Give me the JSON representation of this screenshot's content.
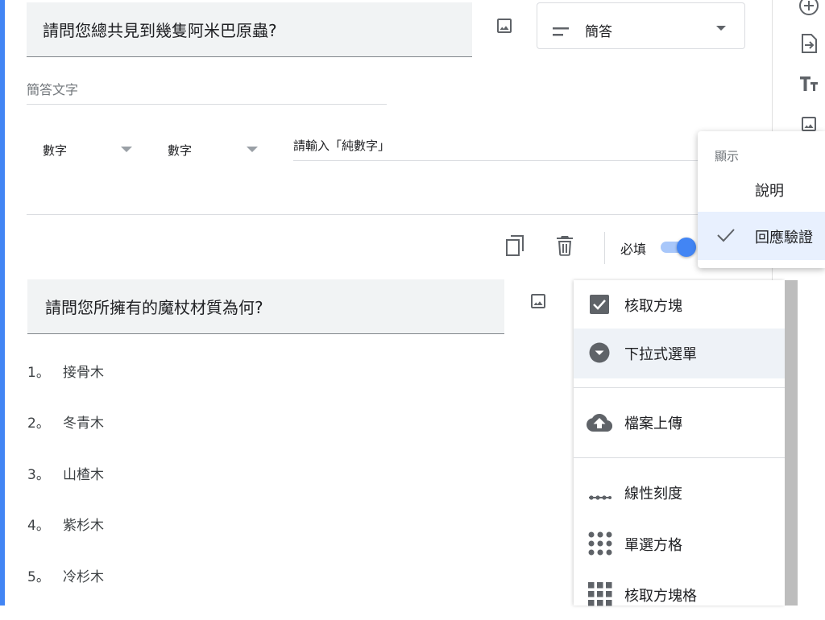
{
  "question1": {
    "title": "請問您總共見到幾隻阿米巴原蟲?",
    "answer_hint": "簡答文字",
    "type_label": "簡答",
    "validation": {
      "kind": "數字",
      "condition": "數字",
      "error_text": "請輸入「純數字」"
    },
    "required_label": "必填",
    "required_on": true
  },
  "display_menu": {
    "header": "顯示",
    "items": [
      {
        "label": "說明",
        "checked": false
      },
      {
        "label": "回應驗證",
        "checked": true
      }
    ]
  },
  "question2": {
    "title": "請問您所擁有的魔杖材質為何?",
    "options": [
      {
        "number": "1。",
        "label": "接骨木"
      },
      {
        "number": "2。",
        "label": "冬青木"
      },
      {
        "number": "3。",
        "label": "山楂木"
      },
      {
        "number": "4。",
        "label": "紫杉木"
      },
      {
        "number": "5。",
        "label": "冷杉木"
      }
    ]
  },
  "type_menu": {
    "items": [
      {
        "label": "核取方塊",
        "icon": "checkbox-icon"
      },
      {
        "label": "下拉式選單",
        "icon": "dropdown-icon"
      },
      {
        "label": "檔案上傳",
        "icon": "cloud-upload-icon"
      },
      {
        "label": "線性刻度",
        "icon": "linear-scale-icon"
      },
      {
        "label": "單選方格",
        "icon": "radio-grid-icon"
      },
      {
        "label": "核取方塊格",
        "icon": "checkbox-grid-icon"
      }
    ]
  },
  "colors": {
    "accent": "#4285f4",
    "highlight": "#eef2f7"
  }
}
